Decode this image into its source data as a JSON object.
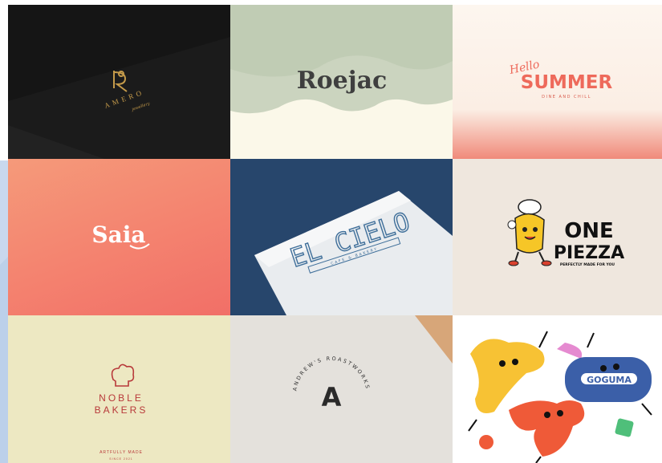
{
  "tiles": {
    "amero": {
      "name": "AMERO",
      "tagline": "jewellery"
    },
    "roejac": {
      "name": "Roejac"
    },
    "summer": {
      "script": "Hello",
      "title": "SUMMER",
      "sub": "DINE AND CHILL"
    },
    "saia": {
      "name": "Saia"
    },
    "cielo": {
      "name": "EL CIELO",
      "sub": "CAFE & BAKERY"
    },
    "piezza": {
      "line1": "ONE",
      "line2": "PIEZZA",
      "sub": "PERFECTLY MADE FOR YOU"
    },
    "noble": {
      "line1": "NOBLE",
      "line2": "BAKERS",
      "sub": "ARTFULLY MADE",
      "since": "SINCE 2021"
    },
    "andrews": {
      "ring": "ANDREW'S ROASTWORKS",
      "letter": "A"
    },
    "goguma": {
      "name": "GOGUMA"
    }
  },
  "colors": {
    "amero_gold": "#c49a4a",
    "roejac_ink": "#3f3f3f",
    "summer_red": "#ee6a5b",
    "cielo_blue": "#3f6f9a",
    "noble_red": "#b8393a",
    "goguma_blue": "#3b5fa8"
  }
}
